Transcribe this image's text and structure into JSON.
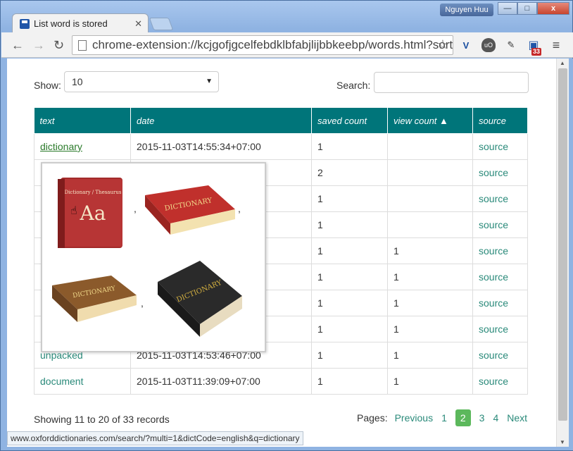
{
  "window": {
    "tab_title": "List word is stored",
    "user_name": "Nguyen Huu",
    "minimize": "—",
    "maximize": "□",
    "close": "x"
  },
  "toolbar": {
    "url": "chrome-extension://kcjgofjgcelfebdklbfabjlijbbkeebp/words.html?sort",
    "ext_badge": "33"
  },
  "controls": {
    "show_label": "Show:",
    "show_value": "10",
    "search_label": "Search:"
  },
  "table": {
    "headers": [
      "text",
      "date",
      "saved count",
      "view count ▲",
      "source"
    ],
    "rows": [
      {
        "text": "dictionary",
        "date": "2015-11-03T14:55:34+07:00",
        "saved": "1",
        "view": "",
        "source": "source"
      },
      {
        "text": "",
        "date": "",
        "saved": "2",
        "view": "",
        "source": "source"
      },
      {
        "text": "",
        "date": "",
        "saved": "1",
        "view": "",
        "source": "source"
      },
      {
        "text": "",
        "date": "",
        "saved": "1",
        "view": "",
        "source": "source"
      },
      {
        "text": "",
        "date": "",
        "saved": "1",
        "view": "1",
        "source": "source"
      },
      {
        "text": "",
        "date": "",
        "saved": "1",
        "view": "1",
        "source": "source"
      },
      {
        "text": "",
        "date": "",
        "saved": "1",
        "view": "1",
        "source": "source"
      },
      {
        "text": "",
        "date": "",
        "saved": "1",
        "view": "1",
        "source": "source"
      },
      {
        "text": "unpacked",
        "date": "2015-11-03T14:53:46+07:00",
        "saved": "1",
        "view": "1",
        "source": "source"
      },
      {
        "text": "document",
        "date": "2015-11-03T11:39:09+07:00",
        "saved": "1",
        "view": "1",
        "source": "source"
      }
    ]
  },
  "tooltip": {
    "comma": ",",
    "book1_title": "Dictionary / Thesaurus",
    "book1_letters": "Aa",
    "book_label": "DICTIONARY"
  },
  "footer": {
    "info": "Showing 11 to 20 of 33 records",
    "pages_label": "Pages:",
    "previous": "Previous",
    "page1": "1",
    "page2": "2",
    "page3": "3",
    "page4": "4",
    "next": "Next"
  },
  "statusbar": {
    "link": "www.oxforddictionaries.com/search/?multi=1&dictCode=english&q=dictionary"
  },
  "colors": {
    "header_bg": "#00757a",
    "link": "#2a8a7a",
    "active_page": "#5cb85c"
  }
}
